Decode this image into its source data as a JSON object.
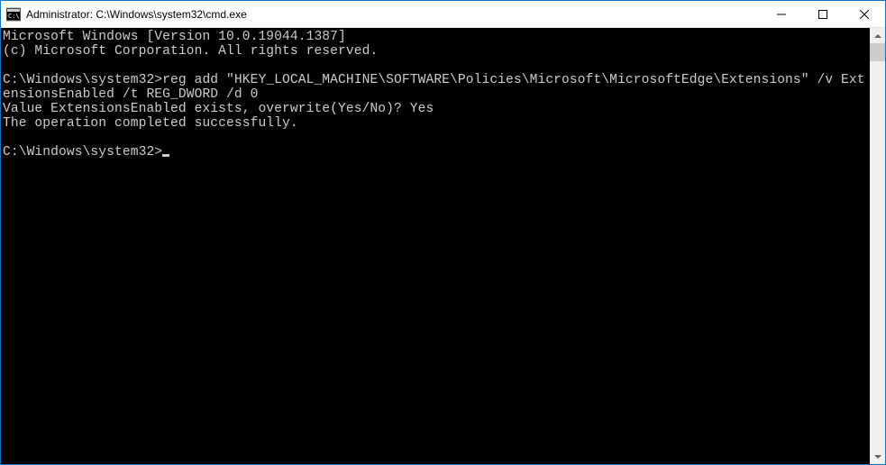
{
  "window": {
    "title": "Administrator: C:\\Windows\\system32\\cmd.exe"
  },
  "console": {
    "line1": "Microsoft Windows [Version 10.0.19044.1387]",
    "line2": "(c) Microsoft Corporation. All rights reserved.",
    "blank1": "",
    "prompt1": "C:\\Windows\\system32>",
    "command1": "reg add \"HKEY_LOCAL_MACHINE\\SOFTWARE\\Policies\\Microsoft\\MicrosoftEdge\\Extensions\" /v ExtensionsEnabled /t REG_DWORD /d 0",
    "response1": "Value ExtensionsEnabled exists, overwrite(Yes/No)? Yes",
    "response2": "The operation completed successfully.",
    "blank2": "",
    "prompt2": "C:\\Windows\\system32>"
  }
}
